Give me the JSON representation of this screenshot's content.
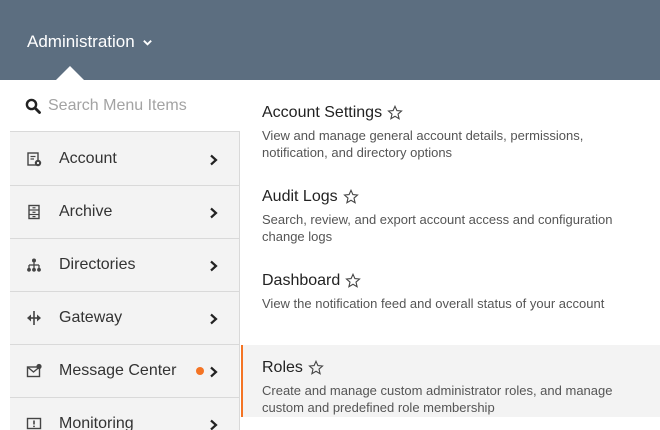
{
  "header": {
    "menu_label": "Administration"
  },
  "search": {
    "placeholder": "Search Menu Items",
    "value": ""
  },
  "menu": {
    "items": [
      {
        "label": "Account",
        "icon": "account-icon"
      },
      {
        "label": "Archive",
        "icon": "archive-icon"
      },
      {
        "label": "Directories",
        "icon": "directories-icon"
      },
      {
        "label": "Gateway",
        "icon": "gateway-icon"
      },
      {
        "label": "Message Center",
        "icon": "message-center-icon",
        "badge": true
      },
      {
        "label": "Monitoring",
        "icon": "monitoring-icon"
      }
    ]
  },
  "submenu": {
    "entries": [
      {
        "title": "Account Settings",
        "desc": "View and manage general account details, permissions, notification, and directory options"
      },
      {
        "title": "Audit Logs",
        "desc": "Search, review, and export account access and configuration change logs"
      },
      {
        "title": "Dashboard",
        "desc": "View the notification feed and overall status of your account"
      },
      {
        "title": "Roles",
        "desc": "Create and manage custom administrator roles, and manage custom and predefined role membership",
        "active": true
      }
    ]
  },
  "colors": {
    "header_bg": "#5c6e80",
    "accent": "#f47424",
    "sidebar_bg": "#f3f3f3"
  }
}
